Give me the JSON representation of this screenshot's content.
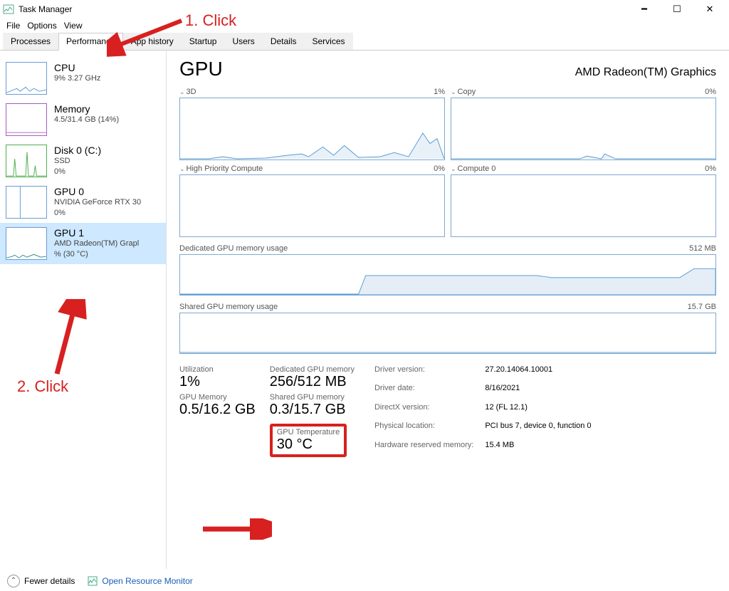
{
  "window": {
    "title": "Task Manager"
  },
  "menu": {
    "file": "File",
    "options": "Options",
    "view": "View"
  },
  "tabs": {
    "processes": "Processes",
    "performance": "Performance",
    "apphistory": "App history",
    "startup": "Startup",
    "users": "Users",
    "details": "Details",
    "services": "Services"
  },
  "sidebar": {
    "cpu": {
      "name": "CPU",
      "sub": "9%  3.27 GHz"
    },
    "memory": {
      "name": "Memory",
      "sub": "4.5/31.4 GB (14%)"
    },
    "disk0": {
      "name": "Disk 0 (C:)",
      "sub1": "SSD",
      "sub2": "0%"
    },
    "gpu0": {
      "name": "GPU 0",
      "sub1": "NVIDIA GeForce RTX 30",
      "sub2": "0%"
    },
    "gpu1": {
      "name": "GPU 1",
      "sub1": "AMD Radeon(TM) Grapl",
      "sub2": "% (30 °C)"
    }
  },
  "main": {
    "title": "GPU",
    "subtitle": "AMD Radeon(TM) Graphics",
    "graph_3d": {
      "name": "3D",
      "pct": "1%"
    },
    "graph_copy": {
      "name": "Copy",
      "pct": "0%"
    },
    "graph_hpc": {
      "name": "High Priority Compute",
      "pct": "0%"
    },
    "graph_compute0": {
      "name": "Compute 0",
      "pct": "0%"
    },
    "mem_dedicated_label": "Dedicated GPU memory usage",
    "mem_dedicated_max": "512 MB",
    "mem_shared_label": "Shared GPU memory usage",
    "mem_shared_max": "15.7 GB",
    "stats": {
      "utilization_label": "Utilization",
      "utilization_value": "1%",
      "dedicated_label": "Dedicated GPU memory",
      "dedicated_value": "256/512 MB",
      "gpumem_label": "GPU Memory",
      "gpumem_value": "0.5/16.2 GB",
      "shared_label": "Shared GPU memory",
      "shared_value": "0.3/15.7 GB",
      "temp_label": "GPU Temperature",
      "temp_value": "30 °C"
    },
    "info": {
      "driver_version_k": "Driver version:",
      "driver_version_v": "27.20.14064.10001",
      "driver_date_k": "Driver date:",
      "driver_date_v": "8/16/2021",
      "directx_k": "DirectX version:",
      "directx_v": "12 (FL 12.1)",
      "physical_k": "Physical location:",
      "physical_v": "PCI bus 7, device 0, function 0",
      "hw_reserved_k": "Hardware reserved memory:",
      "hw_reserved_v": "15.4 MB"
    }
  },
  "footer": {
    "fewer": "Fewer details",
    "orm": "Open Resource Monitor"
  },
  "annotations": {
    "click1": "1. Click",
    "click2": "2. Click"
  }
}
